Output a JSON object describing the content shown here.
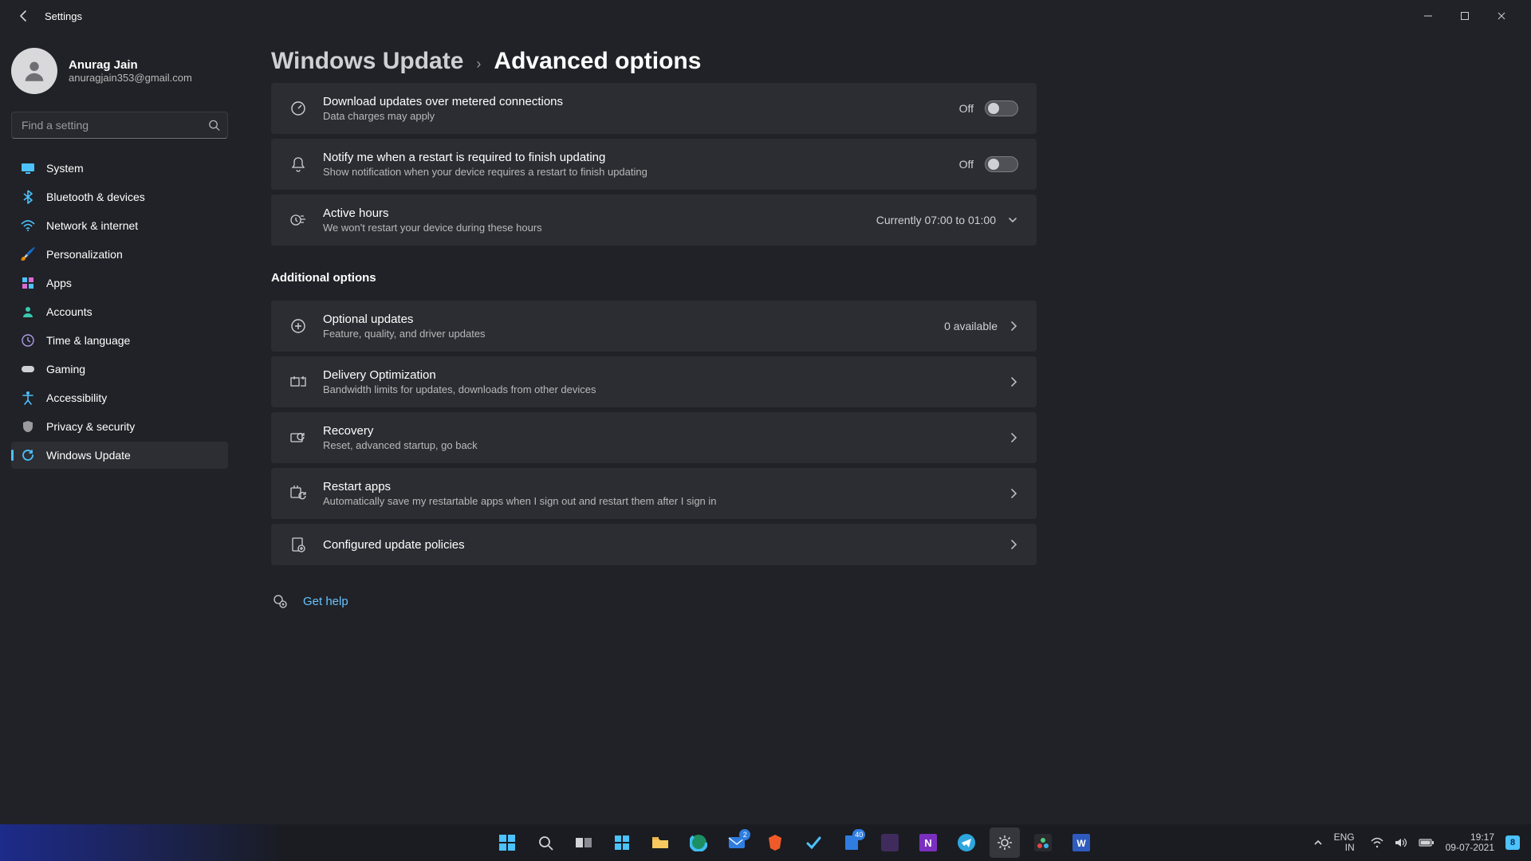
{
  "titlebar": {
    "title": "Settings"
  },
  "profile": {
    "name": "Anurag Jain",
    "email": "anuragjain353@gmail.com"
  },
  "search": {
    "placeholder": "Find a setting"
  },
  "sidebar": {
    "items": [
      {
        "label": "System",
        "icon": "🖥️"
      },
      {
        "label": "Bluetooth & devices",
        "icon": "bt"
      },
      {
        "label": "Network & internet",
        "icon": "📶"
      },
      {
        "label": "Personalization",
        "icon": "🖌️"
      },
      {
        "label": "Apps",
        "icon": "▦"
      },
      {
        "label": "Accounts",
        "icon": "👤"
      },
      {
        "label": "Time & language",
        "icon": "🕒"
      },
      {
        "label": "Gaming",
        "icon": "🎮"
      },
      {
        "label": "Accessibility",
        "icon": "acc"
      },
      {
        "label": "Privacy & security",
        "icon": "🛡️"
      },
      {
        "label": "Windows Update",
        "icon": "↻"
      }
    ],
    "active_index": 10
  },
  "breadcrumb": {
    "parent": "Windows Update",
    "current": "Advanced options"
  },
  "settings": {
    "metered": {
      "title": "Download updates over metered connections",
      "sub": "Data charges may apply",
      "state": "Off"
    },
    "notify_restart": {
      "title": "Notify me when a restart is required to finish updating",
      "sub": "Show notification when your device requires a restart to finish updating",
      "state": "Off"
    },
    "active_hours": {
      "title": "Active hours",
      "sub": "We won't restart your device during these hours",
      "value": "Currently 07:00 to 01:00"
    }
  },
  "section": {
    "additional": "Additional options"
  },
  "additional": {
    "optional": {
      "title": "Optional updates",
      "sub": "Feature, quality, and driver updates",
      "value": "0 available"
    },
    "delivery": {
      "title": "Delivery Optimization",
      "sub": "Bandwidth limits for updates, downloads from other devices"
    },
    "recovery": {
      "title": "Recovery",
      "sub": "Reset, advanced startup, go back"
    },
    "restart_apps": {
      "title": "Restart apps",
      "sub": "Automatically save my restartable apps when I sign out and restart them after I sign in"
    },
    "policies": {
      "title": "Configured update policies"
    }
  },
  "help": {
    "label": "Get help"
  },
  "taskbar": {
    "badges": {
      "mail": "2",
      "word_store": "40"
    },
    "tray": {
      "lang1": "ENG",
      "lang2": "IN",
      "time": "19:17",
      "date": "09-07-2021",
      "notif": "8"
    }
  }
}
